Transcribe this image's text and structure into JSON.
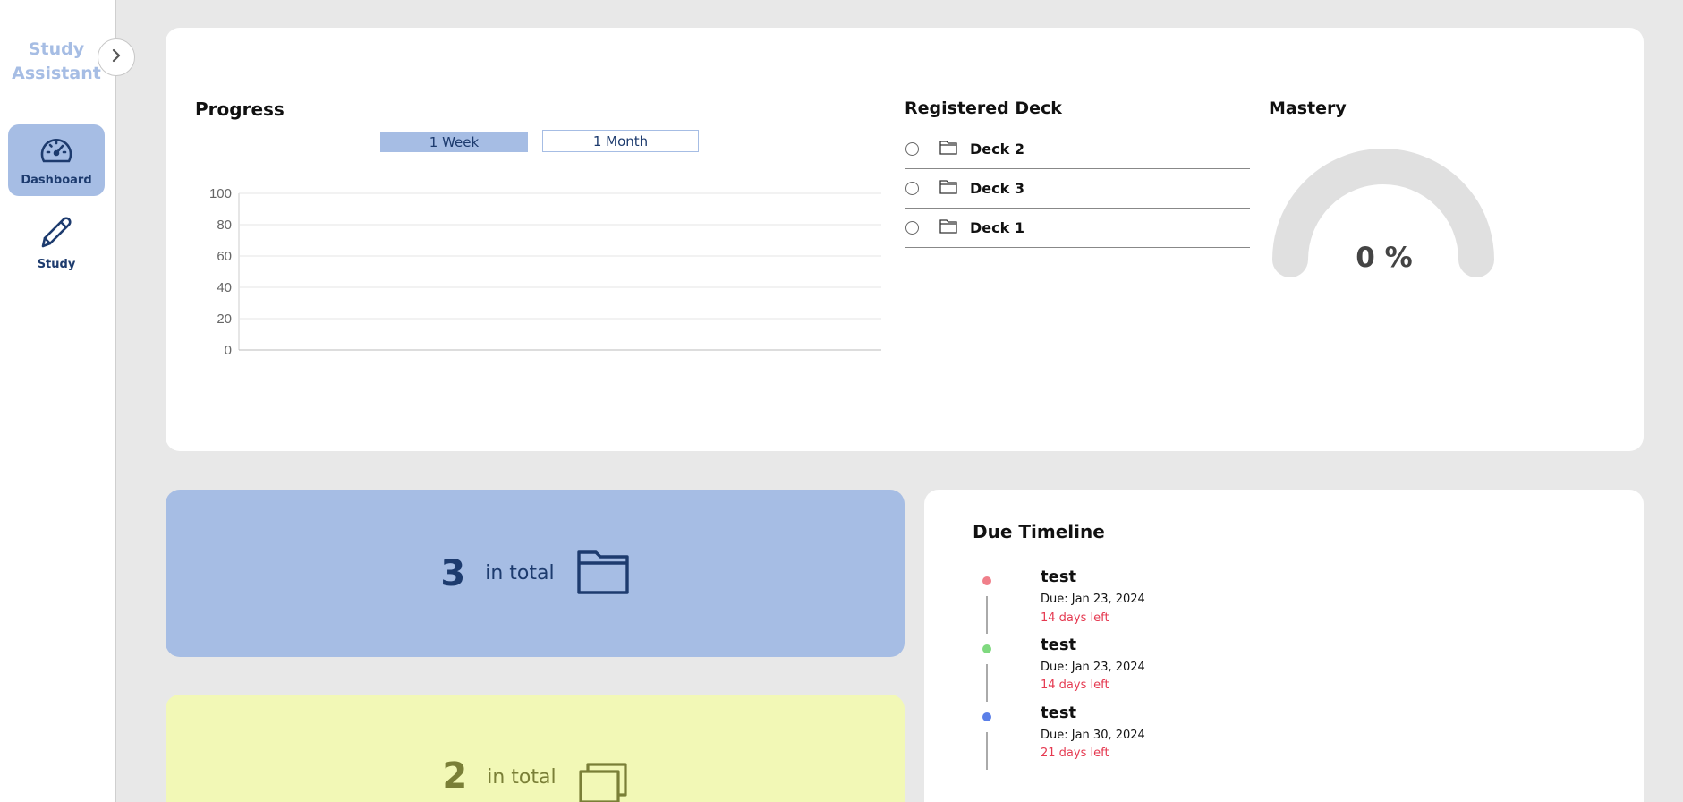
{
  "app": {
    "brand_line1": "Study",
    "brand_line2": "Assistant"
  },
  "sidebar": {
    "items": [
      {
        "label": "Dashboard",
        "icon": "gauge-icon",
        "active": true
      },
      {
        "label": "Study",
        "icon": "pencil-icon",
        "active": false
      }
    ]
  },
  "progress": {
    "title": "Progress",
    "ranges": [
      "1 Week",
      "1 Month"
    ],
    "selected_range": "1 Week",
    "chart_data": {
      "type": "line",
      "title": "",
      "xlabel": "",
      "ylabel": "",
      "ylim": [
        0,
        100
      ],
      "yticks": [
        100,
        80,
        60,
        40,
        20,
        0
      ],
      "categories": [],
      "series": [],
      "grid": true
    }
  },
  "decks": {
    "title": "Registered Deck",
    "items": [
      {
        "name": "Deck 2"
      },
      {
        "name": "Deck 3"
      },
      {
        "name": "Deck 1"
      }
    ]
  },
  "mastery": {
    "title": "Mastery",
    "value_label": "0 %",
    "value": 0
  },
  "stats": {
    "decks": {
      "count": "3",
      "text": "in total",
      "icon": "folder-icon"
    },
    "cards": {
      "count": "2",
      "text": "in total",
      "icon": "cards-stack-icon"
    }
  },
  "timeline": {
    "title": "Due Timeline",
    "items": [
      {
        "title": "test",
        "due": "Due: Jan 23, 2024",
        "left": "14 days left",
        "color": "#f07f8a"
      },
      {
        "title": "test",
        "due": "Due: Jan 23, 2024",
        "left": "14 days left",
        "color": "#7fd97f"
      },
      {
        "title": "test",
        "due": "Due: Jan 30, 2024",
        "left": "21 days left",
        "color": "#5b7fe8"
      }
    ]
  },
  "colors": {
    "accent": "#a6bde4",
    "nav_text": "#1d3b6e",
    "stat_blue_bg": "#a6bde4",
    "stat_blue_fg": "#1d3b6e",
    "stat_yellow_bg": "#f2f8b6",
    "stat_yellow_fg": "#7a7f37",
    "due_red": "#e53950",
    "gauge_track": "#e0e0e0"
  }
}
